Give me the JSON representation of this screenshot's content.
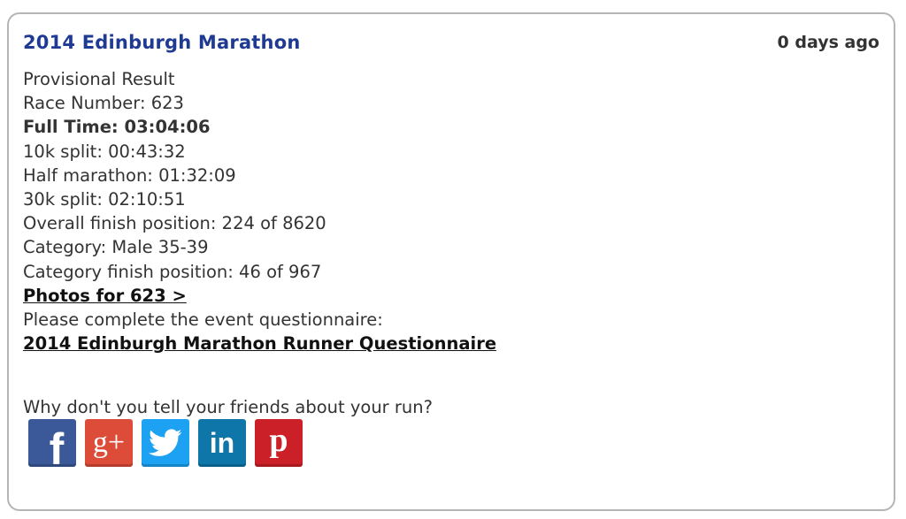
{
  "card": {
    "title": "2014 Edinburgh Marathon",
    "time_ago": "0 days ago",
    "provisional": "Provisional Result",
    "race_number": "Race Number: 623",
    "full_time": "Full Time: 03:04:06",
    "split_10k": "10k split: 00:43:32",
    "half_marathon": "Half marathon: 01:32:09",
    "split_30k": "30k split: 02:10:51",
    "overall_position": "Overall finish position: 224 of 8620",
    "category": "Category: Male 35-39",
    "category_position": "Category finish position: 46 of 967",
    "photos_link": "Photos for 623 >",
    "questionnaire_prompt": "Please complete the event questionnaire:",
    "questionnaire_link": "2014 Edinburgh Marathon Runner Questionnaire",
    "share_prompt": "Why don't you tell your friends about your run?"
  },
  "social": [
    {
      "name": "facebook",
      "icon": "facebook-icon",
      "glyph": "f",
      "color": "#3b5998"
    },
    {
      "name": "google-plus",
      "icon": "google-plus-icon",
      "glyph": "g+",
      "color": "#dd4b39"
    },
    {
      "name": "twitter",
      "icon": "twitter-icon",
      "glyph": "",
      "color": "#1da1f2"
    },
    {
      "name": "linkedin",
      "icon": "linkedin-icon",
      "glyph": "in",
      "color": "#0e76a8"
    },
    {
      "name": "pinterest",
      "icon": "pinterest-icon",
      "glyph": "p",
      "color": "#cb2027"
    }
  ]
}
